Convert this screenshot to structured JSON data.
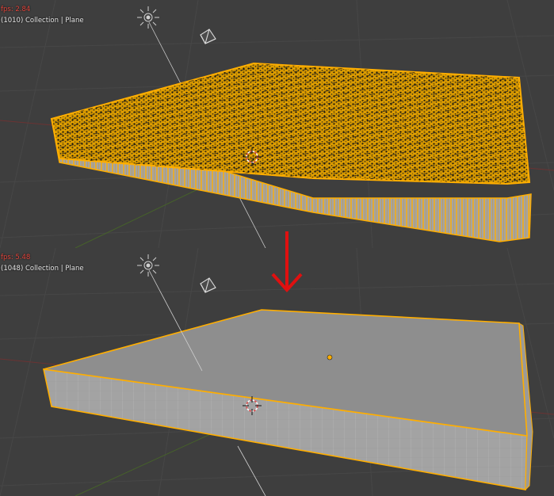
{
  "viewports": {
    "top": {
      "fps": "fps: 2.84",
      "info": "(1010) Collection | Plane"
    },
    "bottom": {
      "fps": "fps: 5.48",
      "info": "(1048) Collection | Plane"
    }
  },
  "colors": {
    "background": "#3e3e3e",
    "grid": "#464646",
    "axis_x": "#7a3a3a",
    "axis_y": "#4d6b2e",
    "selection_outline": "#ffae00",
    "mesh_side": "#a9a9a9",
    "mesh_top": "#8c8c8c",
    "fps_text": "#e3453c",
    "arrow": "#e01010"
  },
  "icons": [
    "light-icon",
    "camera-icon",
    "origin-point-icon",
    "3d-cursor-icon",
    "down-arrow-icon"
  ]
}
